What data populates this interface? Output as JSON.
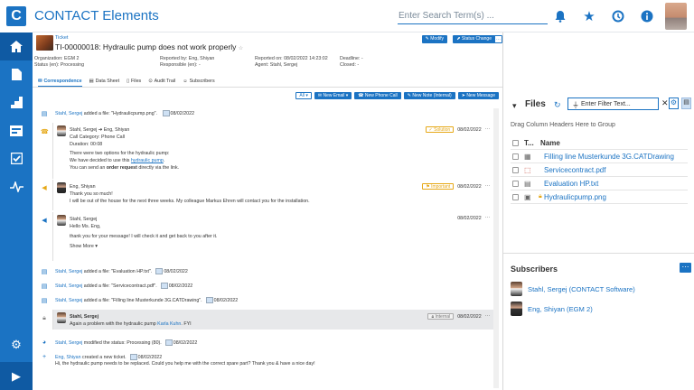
{
  "app": {
    "title": "CONTACT Elements",
    "logo_letter": "C",
    "search_placeholder": "Enter Search Term(s) ..."
  },
  "top_icons": [
    "bell-icon",
    "star-icon",
    "history-icon",
    "info-icon"
  ],
  "sidebar": [
    "home-icon",
    "document-icon",
    "stairs-icon",
    "inbox-icon",
    "checklist-icon",
    "pulse-icon"
  ],
  "ticket": {
    "kind": "Ticket",
    "title": "TI-00000018: Hydraulic pump does not work properly",
    "modify": "Modify",
    "status_change": "Status Change",
    "organization": "Organization:  EGM 2",
    "status": "Status (en):    Processing",
    "reported_by": "Reported by:   Eng, Shiyan",
    "responsible": "Responsible (en):  -",
    "reported_on": "Reported on:  08/02/2022 14:23:02",
    "agent": "Agent:  Stahl, Sergej",
    "deadline": "Deadline:      -",
    "closed": "Closed:          -"
  },
  "tabs": [
    "Correspondence",
    "Data Sheet",
    "Files",
    "Audit Trail",
    "Subscribers"
  ],
  "toolbar": {
    "filter": "All",
    "email": "New Email",
    "phone": "New Phone Call",
    "note": "New Note (Internal)",
    "message": "New Message"
  },
  "feed": {
    "e1": {
      "who": "Stahl, Sergej",
      "text": " added a file: \"Hydraulicpump.png\".",
      "date": "08/02/2022"
    },
    "call": {
      "from": "Stahl, Sergej",
      "arrow": " ➔ ",
      "to": "Eng, Shiyan",
      "badge": "Solution",
      "date": "08/02/2022",
      "lines": [
        "Call Category: Phone Call",
        "Duration: 00:08",
        "",
        "There were two options for the hydraulic pump:"
      ],
      "l5a": "We have decided to use this ",
      "l5b": "hydraulic pump",
      "l5c": ".",
      "l6a": "You can send an ",
      "l6b": "order request",
      "l6c": " directly via the link."
    },
    "msg1": {
      "who": "Eng, Shiyan",
      "badge": "Important",
      "date": "08/02/2022",
      "l1": "Thank you so much!",
      "l2": "I will be out of the house for the next three weeks. My colleague Markus Ehren will contact you for the installation."
    },
    "msg2": {
      "who": "Stahl, Sergej",
      "date": "08/02/2022",
      "l1": "Hello Ms. Eng,",
      "l2": "thank you for your message! I will check it and get back to you after it.",
      "more": "Show More ▾"
    },
    "e2": {
      "who": "Stahl, Sergej",
      "text": " added a file: \"Evaluation HP.txt\".",
      "date": "08/02/2022"
    },
    "e3": {
      "who": "Stahl, Sergej",
      "text": " added a file: \"Servicecontract.pdf\".",
      "date": "08/02/2022"
    },
    "e4": {
      "who": "Stahl, Sergej",
      "text": " added a file: \"Filling line Musterkunde 3G.CATDrawing\".",
      "date": "08/02/2022"
    },
    "note": {
      "who": "Stahl, Sergej",
      "badge": "Internal",
      "date": "08/02/2022",
      "l1a": "Again a problem with the hydraulic pump ",
      "l1b": "Karla Kuhn",
      "l1c": ". FYI"
    },
    "e5": {
      "who": "Stahl, Sergej",
      "text": " modified the status: Processing (80).",
      "date": "08/02/2022"
    },
    "e6": {
      "who": "Eng, Shiyan",
      "text": " created a new ticket.",
      "date": "08/02/2022",
      "body": "Hi, the hydraulic pump needs to be replaced. Could you help me with the correct spare part? Thank you & have a nice day!"
    }
  },
  "files": {
    "title": "Files",
    "filter_placeholder": "Enter Filter Text...",
    "group_hint": "Drag Column Headers Here to Group",
    "col_type": "T...",
    "col_name": "Name",
    "rows": [
      {
        "name": "Filling line Musterkunde 3G.CATDrawing",
        "icon": "drawing-icon"
      },
      {
        "name": "Servicecontract.pdf",
        "icon": "pdf-icon"
      },
      {
        "name": "Evaluation HP.txt",
        "icon": "text-icon"
      },
      {
        "name": "Hydraulicpump.png",
        "icon": "image-icon"
      }
    ]
  },
  "subscribers": {
    "title": "Subscribers",
    "items": [
      "Stahl, Sergej (CONTACT Software)",
      "Eng, Shiyan (EGM 2)"
    ]
  },
  "colors": {
    "accent": "#1b73c3",
    "sidebar": "#1b73c3",
    "solution": "#e6a817",
    "important": "#e6a817"
  }
}
